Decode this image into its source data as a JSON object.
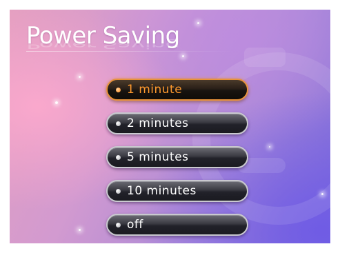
{
  "screen": {
    "title": "Power Saving",
    "background_icon": "stopwatch-icon"
  },
  "menu": {
    "selected_index": 0,
    "items": [
      {
        "label": "1 minute"
      },
      {
        "label": "2 minutes"
      },
      {
        "label": "5 minutes"
      },
      {
        "label": "10 minutes"
      },
      {
        "label": "off"
      }
    ]
  },
  "colors": {
    "selected_accent": "#ff9a2e",
    "item_text": "#ffffff",
    "item_fill": "#1a1a20"
  }
}
